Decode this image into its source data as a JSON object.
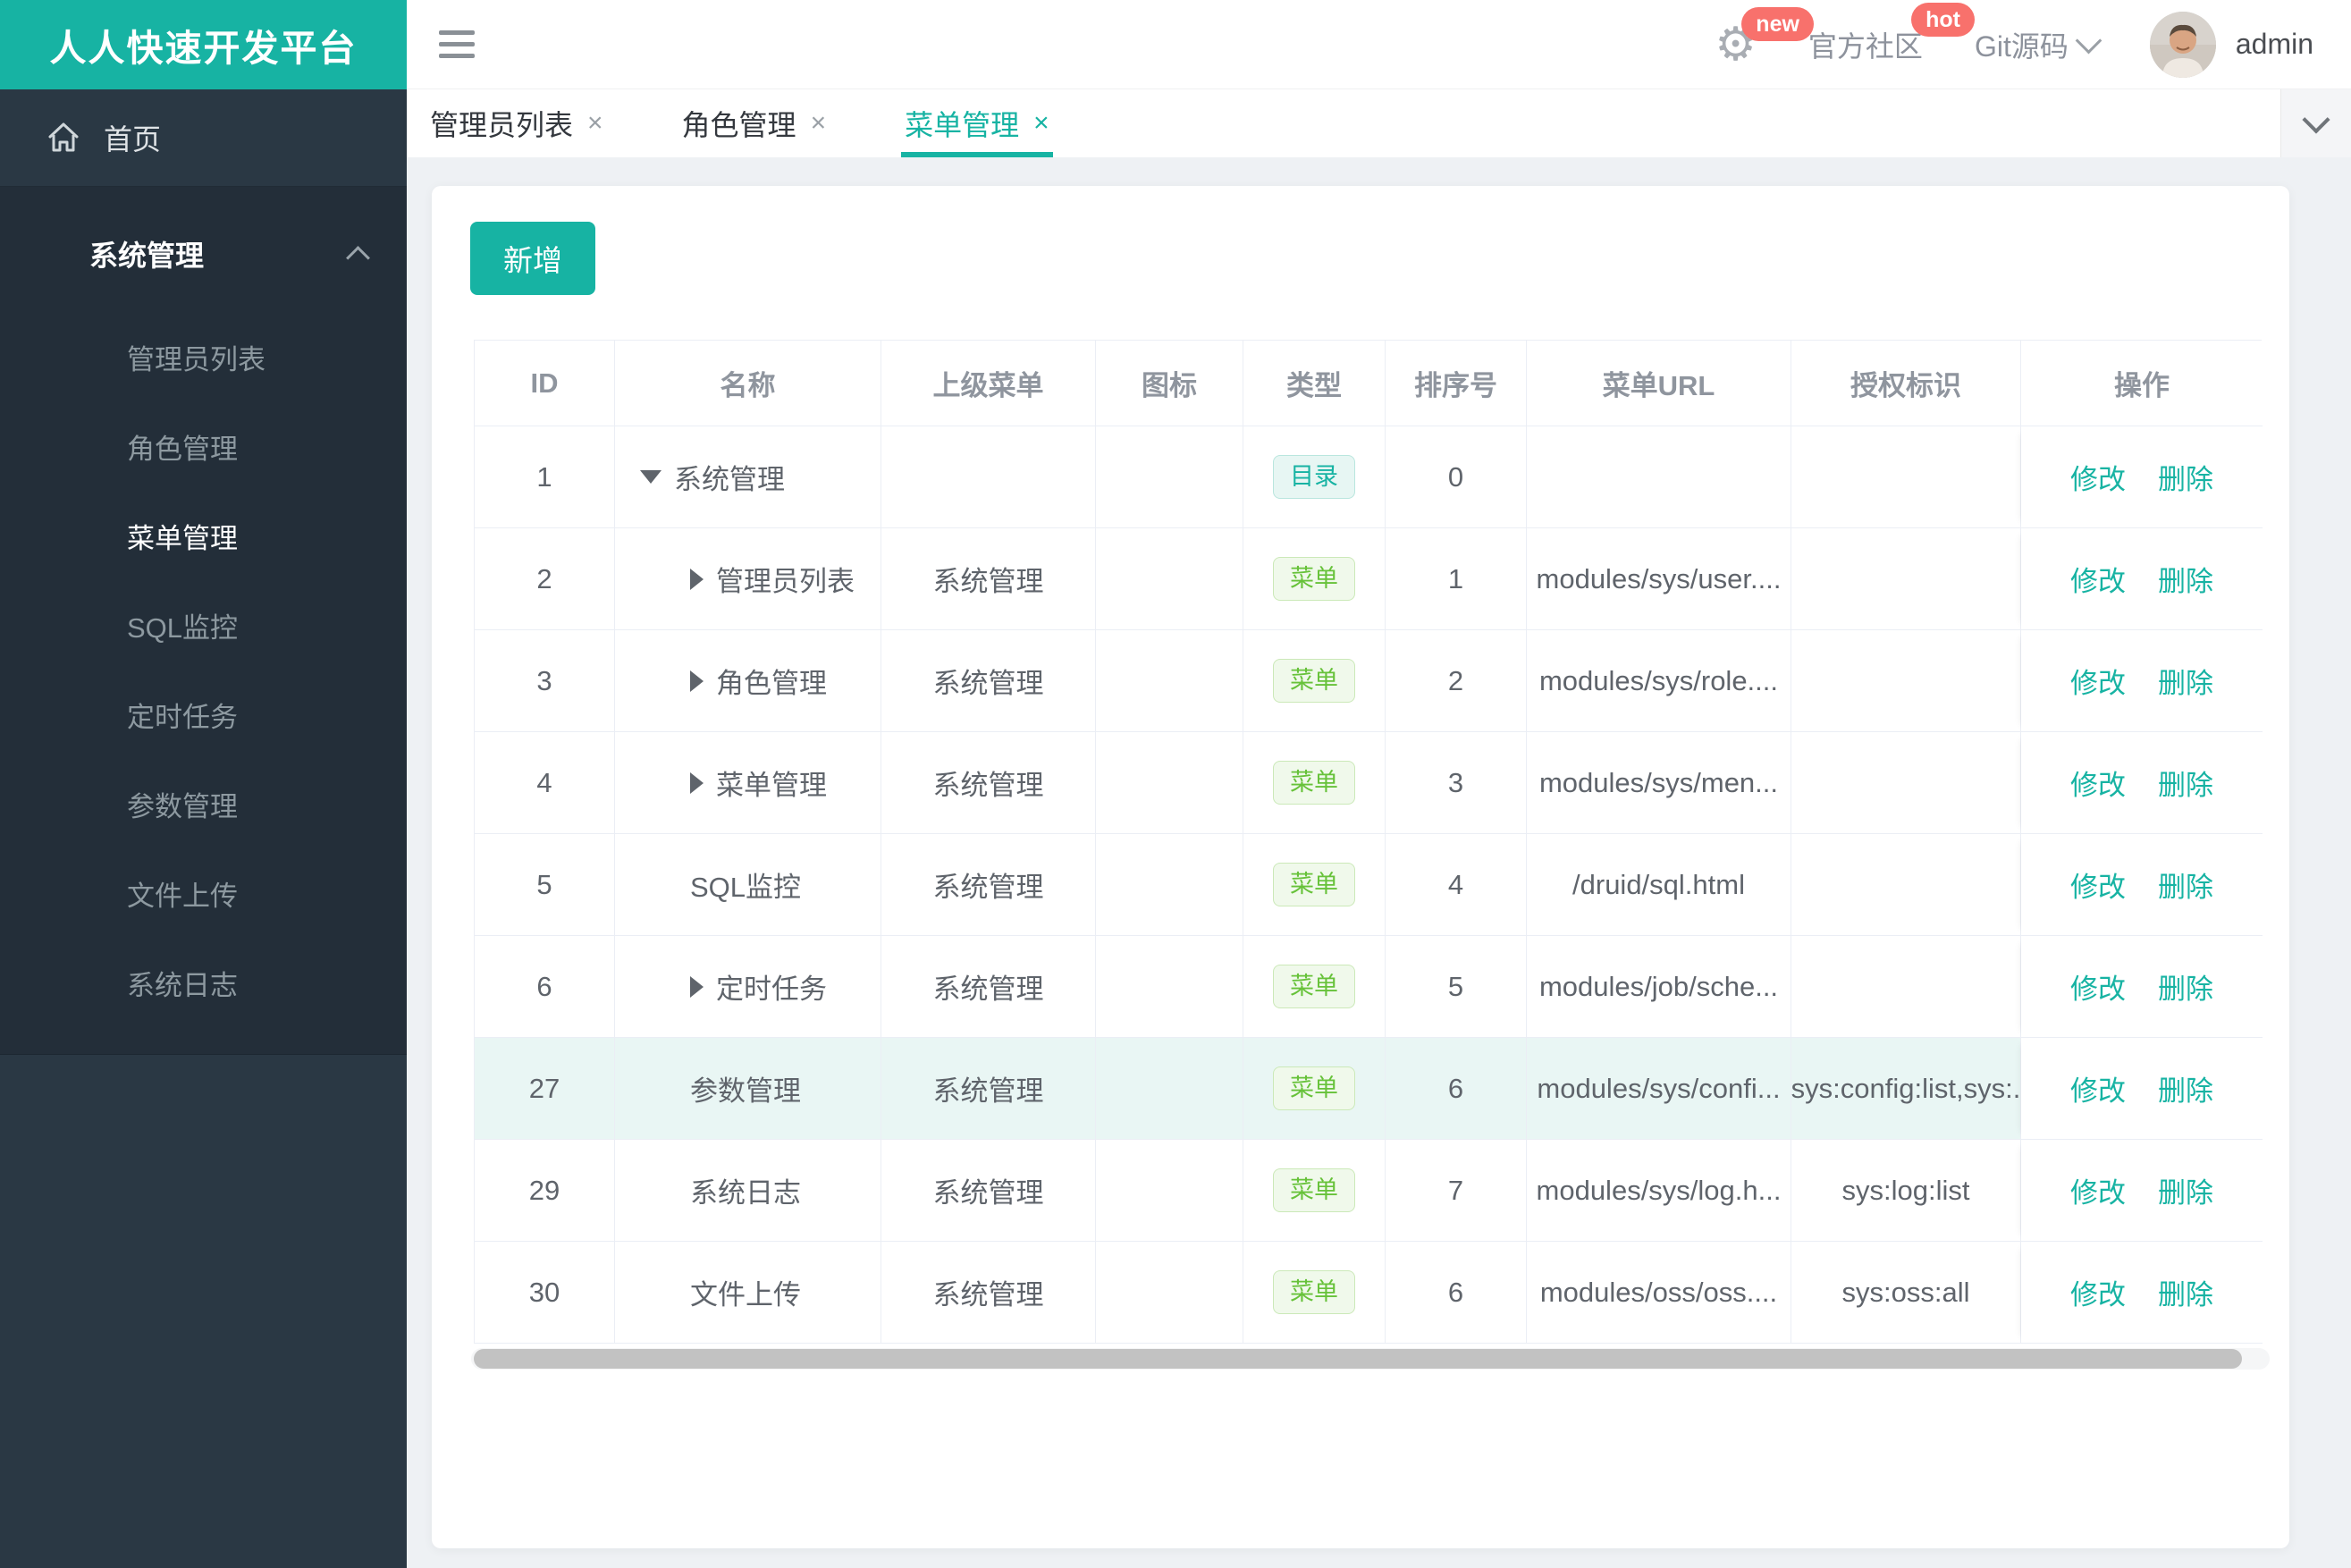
{
  "app": {
    "logo": "人人快速开发平台"
  },
  "topbar": {
    "badge_new": "new",
    "community_label": "官方社区",
    "badge_hot": "hot",
    "git_label": "Git源码",
    "username": "admin"
  },
  "sidebar": {
    "home_label": "首页",
    "group_title": "系统管理",
    "items": [
      {
        "label": "管理员列表",
        "active": false
      },
      {
        "label": "角色管理",
        "active": false
      },
      {
        "label": "菜单管理",
        "active": true
      },
      {
        "label": "SQL监控",
        "active": false
      },
      {
        "label": "定时任务",
        "active": false
      },
      {
        "label": "参数管理",
        "active": false
      },
      {
        "label": "文件上传",
        "active": false
      },
      {
        "label": "系统日志",
        "active": false
      }
    ]
  },
  "tabs": [
    {
      "label": "管理员列表",
      "close": "×",
      "active": false
    },
    {
      "label": "角色管理",
      "close": "×",
      "active": false
    },
    {
      "label": "菜单管理",
      "close": "×",
      "active": true
    }
  ],
  "toolbar": {
    "add_label": "新增"
  },
  "table": {
    "columns": [
      "ID",
      "名称",
      "上级菜单",
      "图标",
      "类型",
      "排序号",
      "菜单URL",
      "授权标识",
      "操作"
    ],
    "actions": {
      "edit": "修改",
      "delete": "删除"
    },
    "type_labels": {
      "dir": "目录",
      "menu": "菜单"
    },
    "rows": [
      {
        "id": "1",
        "arrow": "down",
        "depth": 0,
        "name": "系统管理",
        "parent": "",
        "icon": "",
        "type": "dir",
        "order": "0",
        "url": "",
        "auth": "",
        "highlight": false
      },
      {
        "id": "2",
        "arrow": "right",
        "depth": 1,
        "name": "管理员列表",
        "parent": "系统管理",
        "icon": "",
        "type": "menu",
        "order": "1",
        "url": "modules/sys/user....",
        "auth": "",
        "highlight": false
      },
      {
        "id": "3",
        "arrow": "right",
        "depth": 1,
        "name": "角色管理",
        "parent": "系统管理",
        "icon": "",
        "type": "menu",
        "order": "2",
        "url": "modules/sys/role....",
        "auth": "",
        "highlight": false
      },
      {
        "id": "4",
        "arrow": "right",
        "depth": 1,
        "name": "菜单管理",
        "parent": "系统管理",
        "icon": "",
        "type": "menu",
        "order": "3",
        "url": "modules/sys/men...",
        "auth": "",
        "highlight": false
      },
      {
        "id": "5",
        "arrow": "none",
        "depth": 1,
        "name": "SQL监控",
        "parent": "系统管理",
        "icon": "",
        "type": "menu",
        "order": "4",
        "url": "/druid/sql.html",
        "auth": "",
        "highlight": false
      },
      {
        "id": "6",
        "arrow": "right",
        "depth": 1,
        "name": "定时任务",
        "parent": "系统管理",
        "icon": "",
        "type": "menu",
        "order": "5",
        "url": "modules/job/sche...",
        "auth": "",
        "highlight": false
      },
      {
        "id": "27",
        "arrow": "none",
        "depth": 1,
        "name": "参数管理",
        "parent": "系统管理",
        "icon": "",
        "type": "menu",
        "order": "6",
        "url": "modules/sys/confi...",
        "auth": "sys:config:list,sys:.",
        "highlight": true
      },
      {
        "id": "29",
        "arrow": "none",
        "depth": 1,
        "name": "系统日志",
        "parent": "系统管理",
        "icon": "",
        "type": "menu",
        "order": "7",
        "url": "modules/sys/log.h...",
        "auth": "sys:log:list",
        "highlight": false
      },
      {
        "id": "30",
        "arrow": "none",
        "depth": 1,
        "name": "文件上传",
        "parent": "系统管理",
        "icon": "",
        "type": "menu",
        "order": "6",
        "url": "modules/oss/oss....",
        "auth": "sys:oss:all",
        "highlight": false
      }
    ]
  },
  "colors": {
    "accent_teal": "#17b3a3",
    "badge_red": "#f8716c",
    "tag_menu_green": "#67c23a",
    "sidebar_dark": "#2a3844",
    "sidebar_group_dark": "#232e39",
    "highlight_row": "#e9f6f4"
  }
}
